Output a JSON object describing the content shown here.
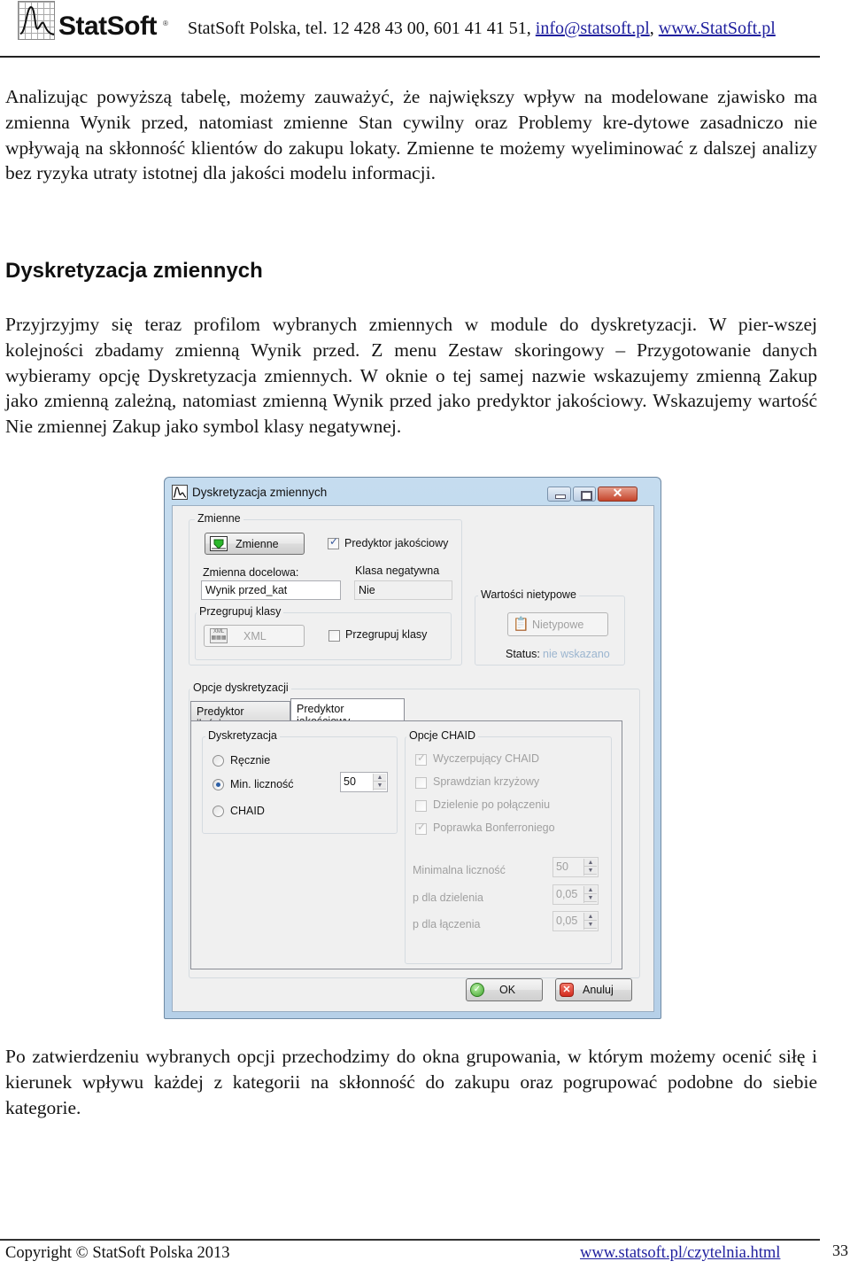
{
  "header": {
    "logo_text": "StatSoft",
    "logo_registered": "®",
    "contact_prefix": "StatSoft Polska, tel. 12 428 43 00, 601 41 41 51, ",
    "email_link": "info@statsoft.pl",
    "separator": ", ",
    "website_link": "www.StatSoft.pl"
  },
  "body": {
    "paragraph_1": "Analizując powyższą tabelę, możemy zauważyć, że największy wpływ na modelowane zjawisko ma zmienna Wynik przed, natomiast zmienne Stan cywilny oraz Problemy kre-dytowe zasadniczo nie wpływają na skłonność klientów do zakupu lokaty. Zmienne te możemy wyeliminować z dalszej analizy bez ryzyka utraty istotnej dla jakości modelu informacji.",
    "section_heading": "Dyskretyzacja zmiennych",
    "paragraph_2": "Przyjrzyjmy się teraz profilom wybranych zmiennych w module do dyskretyzacji. W pier-wszej kolejności zbadamy zmienną Wynik przed. Z menu Zestaw skoringowy – Przygotowanie danych wybieramy opcję Dyskretyzacja zmiennych. W oknie o tej samej nazwie wskazujemy zmienną Zakup jako zmienną zależną, natomiast zmienną Wynik przed jako predyktor jakościowy. Wskazujemy wartość Nie zmiennej Zakup jako symbol klasy negatywnej.",
    "paragraph_3": "Po zatwierdzeniu wybranych opcji przechodzimy do okna grupowania, w którym możemy ocenić siłę i kierunek wpływu każdej z kategorii na skłonność do zakupu oraz pogrupować podobne do siebie kategorie."
  },
  "dialog": {
    "title": "Dyskretyzacja zmiennych",
    "title_buttons": {
      "minimize": "minimize",
      "maximize": "maximize",
      "close": "✕"
    },
    "variables_group": {
      "label": "Zmienne",
      "variables_button": "Zmienne",
      "qualitative_predictor_label": "Predyktor jakościowy",
      "qualitative_predictor_checked": true,
      "target_variable_label": "Zmienna docelowa:",
      "target_variable_value": "Wynik przed_kat",
      "negative_class_label": "Klasa negatywna",
      "negative_class_value": "Nie",
      "regroup_group": {
        "label": "Przegrupuj klasy",
        "xml_button": "XML",
        "xml_icon_text": "XML",
        "regroup_checkbox_label": "Przegrupuj klasy",
        "regroup_checked": false
      }
    },
    "atypical_group": {
      "label": "Wartości nietypowe",
      "button": "Nietypowe",
      "status_label": "Status:",
      "status_value": "nie wskazano"
    },
    "discretization_options": {
      "label": "Opcje dyskretyzacji",
      "tabs": [
        {
          "label": "Predyktor ilościowy",
          "active": false
        },
        {
          "label": "Predyktor jakościowy",
          "active": true
        }
      ],
      "discretization_group": {
        "label": "Dyskretyzacja",
        "options": [
          {
            "label": "Ręcznie",
            "selected": false
          },
          {
            "label": "Min. liczność",
            "selected": true
          },
          {
            "label": "CHAID",
            "selected": false
          }
        ],
        "min_count_value": "50"
      },
      "chaid_group": {
        "label": "Opcje CHAID",
        "checkboxes": [
          {
            "label": "Wyczerpujący CHAID",
            "checked": true,
            "enabled": false
          },
          {
            "label": "Sprawdzian krzyżowy",
            "checked": false,
            "enabled": false
          },
          {
            "label": "Dzielenie po połączeniu",
            "checked": false,
            "enabled": false
          },
          {
            "label": "Poprawka Bonferroniego",
            "checked": true,
            "enabled": false
          }
        ],
        "fields": [
          {
            "label": "Minimalna liczność",
            "value": "50"
          },
          {
            "label": "p dla dzielenia",
            "value": "0,05"
          },
          {
            "label": "p dla łączenia",
            "value": "0,05"
          }
        ]
      }
    },
    "ok_button": "OK",
    "cancel_button": "Anuluj"
  },
  "footer": {
    "copyright": "Copyright © StatSoft Polska 2013",
    "link": "www.statsoft.pl/czytelnia.html",
    "page_number": "33"
  }
}
